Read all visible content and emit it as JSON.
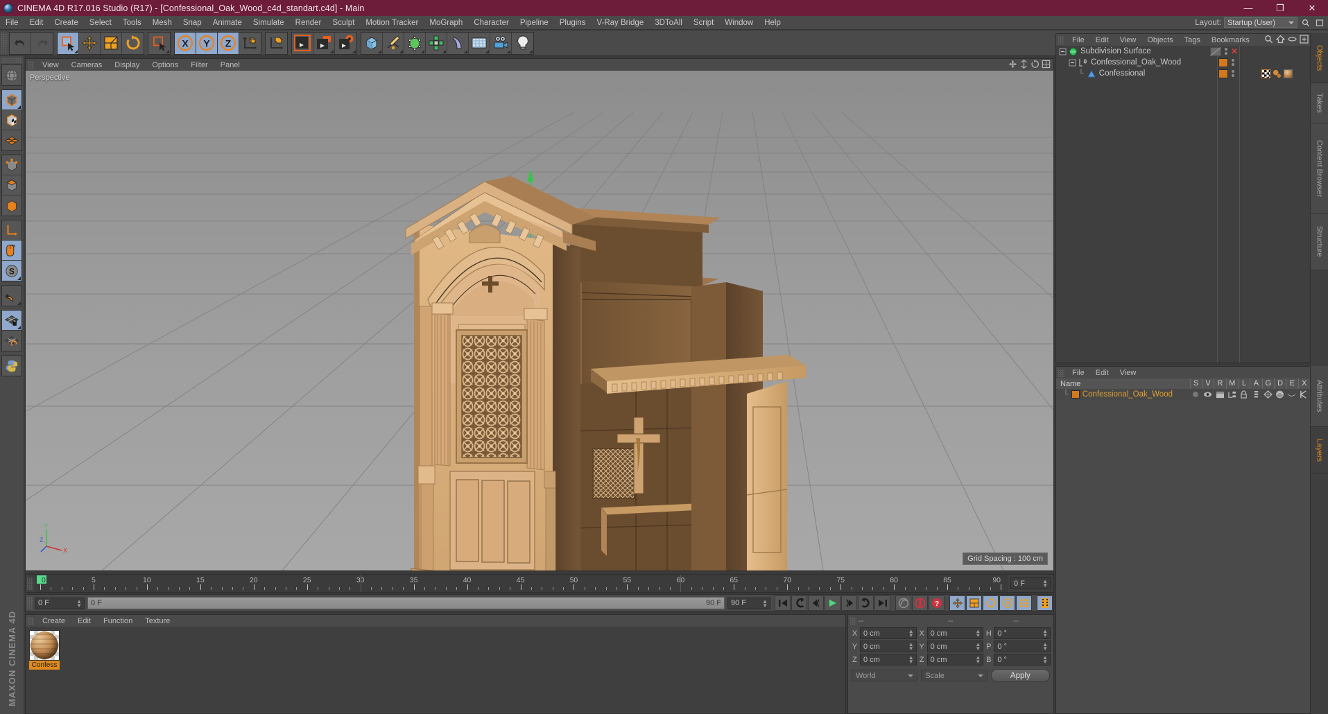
{
  "titlebar": {
    "title": "CINEMA 4D R17.016 Studio (R17) - [Confessional_Oak_Wood_c4d_standart.c4d] - Main",
    "minimize": "—",
    "maximize": "❐",
    "close": "✕",
    "app_icon": "cinema4d-logo-icon"
  },
  "menubar": {
    "items": [
      {
        "label": "File"
      },
      {
        "label": "Edit"
      },
      {
        "label": "Create"
      },
      {
        "label": "Select"
      },
      {
        "label": "Tools"
      },
      {
        "label": "Mesh"
      },
      {
        "label": "Snap"
      },
      {
        "label": "Animate"
      },
      {
        "label": "Simulate"
      },
      {
        "label": "Render"
      },
      {
        "label": "Sculpt"
      },
      {
        "label": "Motion Tracker"
      },
      {
        "label": "MoGraph"
      },
      {
        "label": "Character"
      },
      {
        "label": "Pipeline"
      },
      {
        "label": "Plugins"
      },
      {
        "label": "V-Ray Bridge"
      },
      {
        "label": "3DToAll"
      },
      {
        "label": "Script"
      },
      {
        "label": "Window"
      },
      {
        "label": "Help"
      }
    ],
    "layout_label": "Layout:",
    "layout_value": "Startup (User)"
  },
  "toolbar": {
    "groups": [
      {
        "name": "history",
        "buttons": [
          {
            "name": "undo-button",
            "icon": "undo-arrow-icon",
            "selected": false
          },
          {
            "name": "redo-button",
            "icon": "redo-arrow-icon",
            "selected": false,
            "disabled": true
          }
        ]
      },
      {
        "name": "transform",
        "buttons": [
          {
            "name": "live-selection-tool",
            "icon": "select-cursor-icon",
            "selected": true
          },
          {
            "name": "move-tool",
            "icon": "move-arrows-icon",
            "selected": false
          },
          {
            "name": "scale-tool",
            "icon": "scale-box-icon",
            "selected": false
          },
          {
            "name": "rotate-tool",
            "icon": "rotate-circle-icon",
            "selected": false
          }
        ]
      },
      {
        "name": "selection",
        "buttons": [
          {
            "name": "selection-tool",
            "icon": "select-cursor-icon",
            "selected": false
          }
        ]
      },
      {
        "name": "axis-lock",
        "buttons": [
          {
            "name": "lock-x-axis",
            "icon": "x-axis-icon",
            "label": "X",
            "selected": true
          },
          {
            "name": "lock-y-axis",
            "icon": "y-axis-icon",
            "label": "Y",
            "selected": true
          },
          {
            "name": "lock-z-axis",
            "icon": "z-axis-icon",
            "label": "Z",
            "selected": true
          },
          {
            "name": "world-object-coordinate-toggle",
            "icon": "world-axis-cube-icon",
            "selected": false
          }
        ]
      },
      {
        "name": "render",
        "buttons": [
          {
            "name": "render-view-button",
            "icon": "clapboard-play-icon",
            "selected": false
          },
          {
            "name": "render-to-picture-viewer-button",
            "icon": "clapboard-picture-icon",
            "selected": false
          },
          {
            "name": "render-settings-button",
            "icon": "clapboard-gear-icon",
            "selected": false
          }
        ]
      },
      {
        "name": "create",
        "buttons": [
          {
            "name": "add-cube-primitive",
            "icon": "cube-icon",
            "selected": false
          },
          {
            "name": "add-spline",
            "icon": "pen-spline-icon",
            "selected": false
          },
          {
            "name": "add-generator",
            "icon": "hypernurbs-cube-icon",
            "selected": false
          },
          {
            "name": "add-mograph-cloner",
            "icon": "mograph-array-icon",
            "selected": false
          },
          {
            "name": "add-deformer",
            "icon": "bend-deformer-icon",
            "selected": false
          },
          {
            "name": "add-environment",
            "icon": "floor-grid-icon",
            "selected": false
          },
          {
            "name": "add-camera",
            "icon": "camera-icon",
            "selected": false
          },
          {
            "name": "add-light",
            "icon": "lightbulb-icon",
            "selected": false
          }
        ]
      }
    ]
  },
  "left_toolbar": {
    "groups": [
      {
        "buttons": [
          {
            "name": "undo-view-button",
            "icon": "globe-sphere-icon",
            "selected": false
          }
        ]
      },
      {
        "buttons": [
          {
            "name": "model-mode",
            "icon": "model-cube-icon",
            "selected": true
          },
          {
            "name": "texture-mode",
            "icon": "texture-checker-cube-icon",
            "selected": false
          },
          {
            "name": "workplane-mode",
            "icon": "workplane-grid-icon",
            "selected": false
          }
        ]
      },
      {
        "buttons": [
          {
            "name": "points-mode",
            "icon": "points-cube-icon",
            "selected": false
          },
          {
            "name": "edges-mode",
            "icon": "edges-cube-icon",
            "selected": false
          },
          {
            "name": "polygons-mode",
            "icon": "polygons-cube-icon",
            "selected": false
          }
        ]
      },
      {
        "buttons": [
          {
            "name": "enable-axis-modification",
            "icon": "axis-l-arrow-icon",
            "selected": false
          },
          {
            "name": "viewport-solo-single",
            "icon": "mouse-icon",
            "selected": true
          },
          {
            "name": "enable-snapping-s",
            "icon": "s-sphere-icon",
            "selected": true
          }
        ]
      },
      {
        "buttons": [
          {
            "name": "magnet-tool",
            "icon": "magnet-icon",
            "selected": false
          }
        ]
      },
      {
        "buttons": [
          {
            "name": "lock-workplane",
            "icon": "grid-lock-icon",
            "selected": true
          },
          {
            "name": "planar-workplane",
            "icon": "grid-rotate-icon",
            "selected": false
          }
        ]
      },
      {
        "buttons": [
          {
            "name": "python-script",
            "icon": "python-icon",
            "selected": false
          }
        ]
      }
    ],
    "brand_line1": "MAXON",
    "brand_line2": "CINEMA 4D"
  },
  "viewport": {
    "menu": [
      {
        "label": "View"
      },
      {
        "label": "Cameras"
      },
      {
        "label": "Display"
      },
      {
        "label": "Options"
      },
      {
        "label": "Filter"
      },
      {
        "label": "Panel"
      }
    ],
    "perspective_label": "Perspective",
    "grid_spacing": "Grid Spacing : 100 cm",
    "axis_labels": {
      "x": "X",
      "y": "Y",
      "z": "Z"
    },
    "nav_icons": [
      "move-view-icon",
      "scale-view-icon",
      "rotate-view-icon",
      "maximize-view-icon"
    ]
  },
  "timeline": {
    "ticks": [
      0,
      5,
      10,
      15,
      20,
      25,
      30,
      35,
      40,
      45,
      50,
      55,
      60,
      65,
      70,
      75,
      80,
      85,
      90
    ],
    "range_start": 0,
    "range_end": 90,
    "playhead_frame": "0",
    "end_field": "0 F"
  },
  "transport": {
    "current_frame": "0 F",
    "scrub_left": "0 F",
    "scrub_right": "90 F",
    "preview_end": "90 F",
    "buttons": [
      {
        "name": "go-to-start-button",
        "icon": "skip-start-icon"
      },
      {
        "name": "previous-keyframe-button",
        "icon": "prev-key-icon"
      },
      {
        "name": "step-back-button",
        "icon": "step-back-icon"
      },
      {
        "name": "play-button",
        "icon": "play-icon"
      },
      {
        "name": "step-forward-button",
        "icon": "step-forward-icon"
      },
      {
        "name": "next-keyframe-button",
        "icon": "next-key-icon"
      },
      {
        "name": "go-to-end-button",
        "icon": "skip-end-icon"
      },
      {
        "name": "autokeying-button",
        "icon": "curve-icon"
      },
      {
        "name": "record-active-objects-button",
        "icon": "record-circle-icon"
      },
      {
        "name": "autokeying-toggle-button",
        "icon": "record-question-icon"
      },
      {
        "name": "key-position-button",
        "icon": "position-arrows-icon"
      },
      {
        "name": "key-scale-button",
        "icon": "scale-key-icon"
      },
      {
        "name": "key-rotation-button",
        "icon": "rotation-key-icon"
      },
      {
        "name": "key-parameter-button",
        "icon": "parameter-p-icon"
      },
      {
        "name": "key-point-level-animation-button",
        "icon": "pla-dots-icon"
      },
      {
        "name": "timeline-toggle-button",
        "icon": "film-strip-icon"
      }
    ]
  },
  "material_manager": {
    "menu": [
      {
        "label": "Create"
      },
      {
        "label": "Edit"
      },
      {
        "label": "Function"
      },
      {
        "label": "Texture"
      }
    ],
    "materials": [
      {
        "name": "Confess",
        "icon": "material-sphere-icon"
      }
    ]
  },
  "coordinates": {
    "header_cols": [
      "--",
      "--",
      "--"
    ],
    "position": [
      {
        "axis": "X",
        "value": "0 cm"
      },
      {
        "axis": "Y",
        "value": "0 cm"
      },
      {
        "axis": "Z",
        "value": "0 cm"
      }
    ],
    "size": [
      {
        "axis": "X",
        "value": "0 cm"
      },
      {
        "axis": "Y",
        "value": "0 cm"
      },
      {
        "axis": "Z",
        "value": "0 cm"
      }
    ],
    "rotation": [
      {
        "axis": "H",
        "value": "0 °"
      },
      {
        "axis": "P",
        "value": "0 °"
      },
      {
        "axis": "B",
        "value": "0 °"
      }
    ],
    "coord_system": "World",
    "size_mode": "Scale",
    "apply_label": "Apply"
  },
  "object_manager": {
    "menu": [
      {
        "label": "File"
      },
      {
        "label": "Edit"
      },
      {
        "label": "View"
      },
      {
        "label": "Objects"
      },
      {
        "label": "Tags"
      },
      {
        "label": "Bookmarks"
      }
    ],
    "header_icons": [
      "search-icon",
      "home-icon",
      "ellipse-icon",
      "plus-box-icon"
    ],
    "rows": [
      {
        "label": "Subdivision Surface",
        "depth": 0,
        "icon": "subdivision-surface-icon",
        "dots": "visibility-dots",
        "tags": [],
        "close_x": true,
        "layer_color": "none"
      },
      {
        "label": "Confessional_Oak_Wood",
        "depth": 1,
        "icon": "null-object-icon",
        "dots": "visibility-dots",
        "tags": [],
        "close_x": false,
        "layer_color": "#d4781e"
      },
      {
        "label": "Confessional",
        "depth": 2,
        "icon": "polygon-object-icon",
        "dots": "visibility-dots",
        "tags": [
          "texture-tag-icon",
          "material-tag-icon",
          "material-preview-icon"
        ],
        "close_x": false,
        "layer_color": "#d4781e"
      }
    ]
  },
  "layer_manager": {
    "menu": [
      {
        "label": "File"
      },
      {
        "label": "Edit"
      },
      {
        "label": "View"
      }
    ],
    "columns": [
      "Name",
      "S",
      "V",
      "R",
      "M",
      "L",
      "A",
      "G",
      "D",
      "E",
      "X"
    ],
    "rows": [
      {
        "name": "Confessional_Oak_Wood",
        "color": "#d4781e",
        "cells": [
          "solo-dot",
          "view-eye-icon",
          "render-clapboard-icon",
          "manager-icon",
          "lock-icon",
          "animation-icon",
          "generator-icon",
          "deformer-icon",
          "expression-icon",
          "xref-icon"
        ]
      }
    ]
  },
  "right_tabs": [
    {
      "label": "Objects",
      "active": true
    },
    {
      "label": "Takes",
      "active": false
    },
    {
      "label": "Content Browser",
      "active": false
    },
    {
      "label": "Structure",
      "active": false
    },
    {
      "label": "Attributes",
      "active": false
    },
    {
      "label": "Layers",
      "active": true
    }
  ],
  "colors": {
    "title_bar": "#6d1c3a",
    "panel_bg": "#4a4a4a",
    "dark_bg": "#3f3f3f",
    "accent_orange": "#e08b1e",
    "selected_blue": "#8fa8cb",
    "viewport_gray": "#9a9a9a",
    "wood_tan": "#d4a574"
  }
}
